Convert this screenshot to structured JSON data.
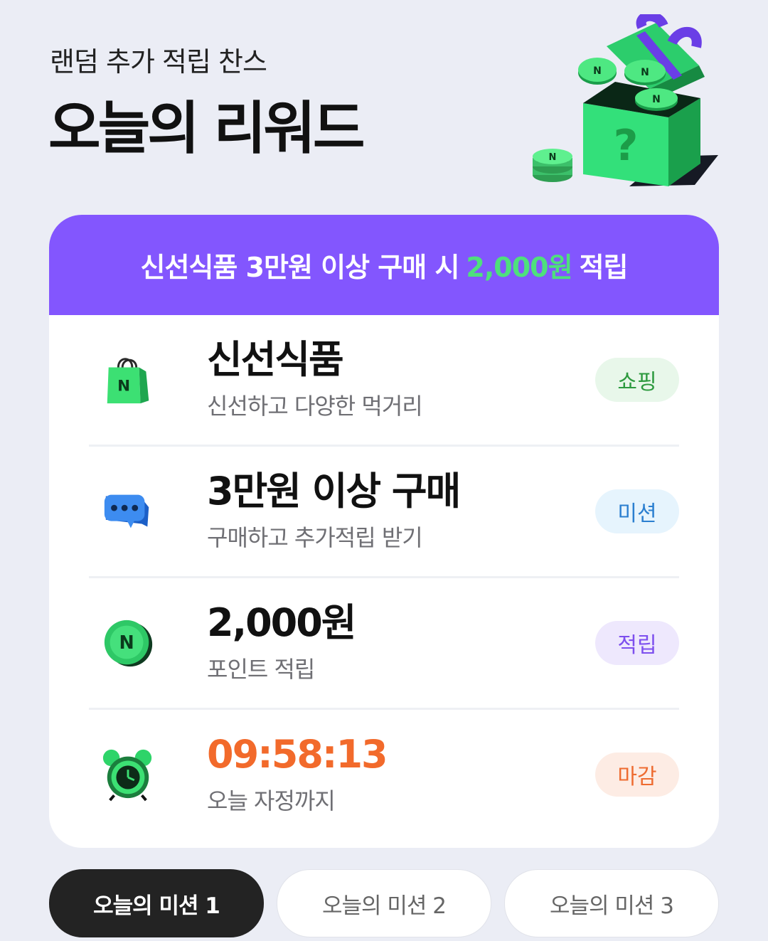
{
  "header": {
    "subtitle": "랜덤 추가 적립 찬스",
    "title": "오늘의 리워드"
  },
  "banner": {
    "prefix": "신선식품 3만원 이상 구매 시",
    "amount": "2,000원",
    "suffix": "적립"
  },
  "rows": [
    {
      "title": "신선식품",
      "desc": "신선하고 다양한 먹거리",
      "badge": "쇼핑",
      "icon": "shopping-bag-icon"
    },
    {
      "title": "3만원 이상 구매",
      "desc": "구매하고 추가적립 받기",
      "badge": "미션",
      "icon": "chat-bubble-icon"
    },
    {
      "title": "2,000원",
      "desc": "포인트 적립",
      "badge": "적립",
      "icon": "coin-icon"
    },
    {
      "title": "09:58:13",
      "desc": "오늘 자정까지",
      "badge": "마감",
      "icon": "alarm-clock-icon"
    }
  ],
  "tabs": [
    {
      "label": "오늘의 미션 1",
      "active": true
    },
    {
      "label": "오늘의 미션 2",
      "active": false
    },
    {
      "label": "오늘의 미션 3",
      "active": false
    }
  ],
  "colors": {
    "banner": "#8356fe",
    "highlight": "#4ee07c",
    "timer": "#f26a2b",
    "background": "#ebedf5"
  }
}
